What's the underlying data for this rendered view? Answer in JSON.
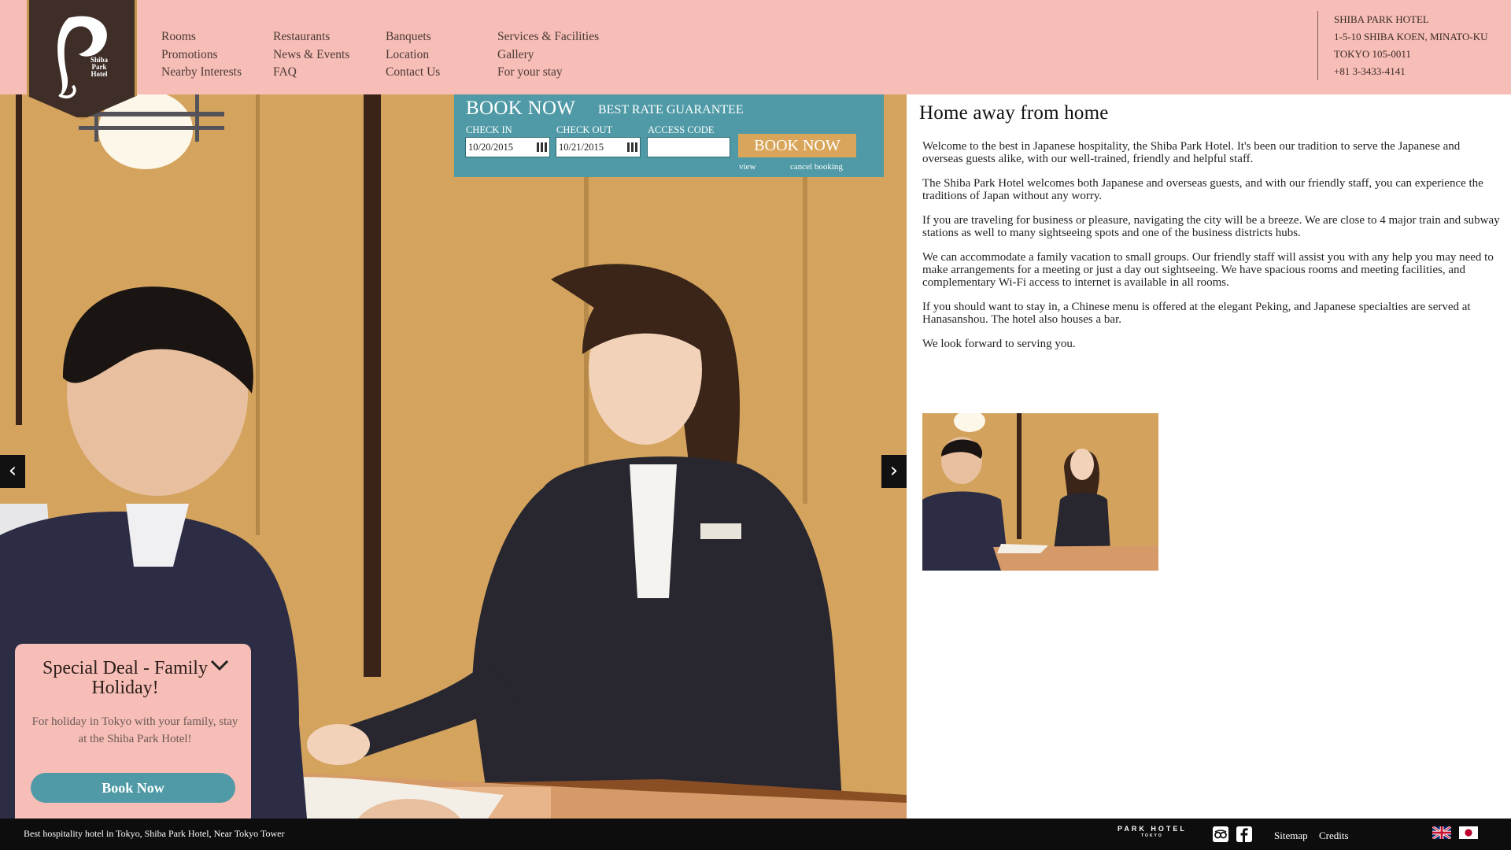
{
  "header": {
    "logo_text": "Shiba Park Hotel",
    "nav_columns": [
      [
        "Rooms",
        "Promotions",
        "Nearby Interests"
      ],
      [
        "Restaurants",
        "News & Events",
        "FAQ"
      ],
      [
        "Banquets",
        "Location",
        "Contact Us"
      ],
      [
        "Services & Facilities",
        "Gallery",
        "For your stay"
      ]
    ],
    "hotel_info": {
      "name": "SHIBA PARK HOTEL",
      "address1": "1-5-10 SHIBA KOEN, MINATO-KU",
      "address2": "TOKYO 105-0011",
      "phone": "+81 3-3433-4141"
    }
  },
  "booking": {
    "title": "BOOK NOW",
    "rate": "BEST RATE GUARANTEE",
    "check_in_label": "CHECK IN",
    "check_in_value": "10/20/2015",
    "check_out_label": "CHECK OUT",
    "check_out_value": "10/21/2015",
    "access_code_label": "ACCESS CODE",
    "access_code_value": "",
    "button": "BOOK NOW",
    "view_link": "view",
    "cancel_link": "cancel booking"
  },
  "hero": {
    "prev_arrow": "‹",
    "next_arrow": "›"
  },
  "content": {
    "title": "Home away from home",
    "paragraphs": [
      "Welcome to the best in Japanese hospitality, the Shiba Park Hotel. It's been our tradition to serve the Japanese and overseas guests alike, with our well-trained, friendly and helpful staff.",
      "The Shiba Park Hotel welcomes both Japanese and overseas guests, and with our friendly staff, you can experience the traditions of Japan without any worry.",
      "If you are traveling for business or pleasure, navigating the city will be a breeze. We are close to 4 major train and subway stations as well to many sightseeing spots and one of the business districts hubs.",
      "We can accommodate a family vacation to small groups. Our friendly staff will assist you with any help you may need to make arrangements for a meeting or just a day out sightseeing. We have spacious rooms and meeting facilities, and complementary Wi-Fi access to internet is available in all rooms.",
      "If you should want to stay in, a Chinese menu is offered at the elegant Peking, and Japanese specialties are served at Hanasanshou. The hotel also houses a bar.",
      "We look forward to serving you."
    ]
  },
  "deal": {
    "title": "Special Deal - Family Holiday!",
    "text": "For holiday in Tokyo with your family, stay at the Shiba Park Hotel!",
    "button": "Book Now"
  },
  "footer": {
    "tagline": "Best hospitality hotel in Tokyo,  Shiba Park Hotel, Near Tokyo Tower",
    "park_logo": "PARK HOTEL",
    "park_logo_sub": "TOKYO",
    "sitemap": "Sitemap",
    "credits": "Credits"
  },
  "colors": {
    "header_bg": "#f7bdb7",
    "accent_teal": "#4f9aa6",
    "accent_gold": "#d9a55a",
    "logo_brown": "#3f2e28",
    "footer_bg": "#0d0d0d"
  },
  "icons": [
    "calendar-icon",
    "chevron-left-icon",
    "chevron-right-icon",
    "chevron-down-icon",
    "tripadvisor-icon",
    "facebook-icon",
    "flag-uk-icon",
    "flag-japan-icon"
  ]
}
